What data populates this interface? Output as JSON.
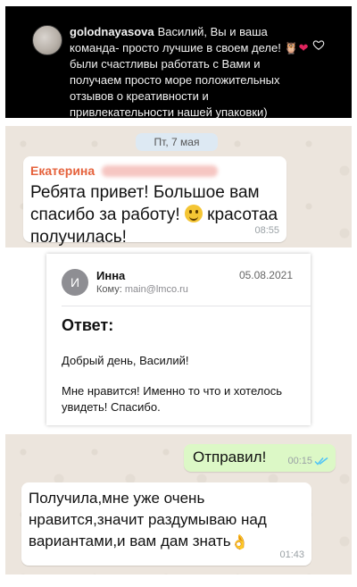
{
  "instagram": {
    "username": "golodnayasova",
    "comment_part1": "Василий, Вы и ваша команда- просто лучшие в своем деле! ",
    "comment_part2": " были счастливы работать с Вами и получаем просто море положительных отзывов о креативности и привлекательности нашей упаковки)",
    "icons": [
      "avatar",
      "owl-emoji",
      "red-heart-emoji",
      "like-heart-icon"
    ]
  },
  "chat1": {
    "date": "Пт, 7 мая",
    "sender": "Екатерина",
    "message_part1": "Ребята привет! Большое вам спасибо за работу! ",
    "message_part2": " красотаа получилась!",
    "time": "08:55"
  },
  "email": {
    "avatar_letter": "И",
    "from": "Инна",
    "to_label": "Кому:",
    "to_address": "main@lmco.ru",
    "date": "05.08.2021",
    "subject": "Ответ:",
    "greeting": "Добрый день, Василий!",
    "body": "Мне нравится! Именно то что и хотелось увидеть! Спасибо."
  },
  "chat2": {
    "outgoing": {
      "text": "Отправил!",
      "time": "00:15"
    },
    "incoming": {
      "text": "Получила,мне уже очень нравится,значит раздумываю над вариантами,и вам дам знать",
      "time": "01:43"
    }
  },
  "colors": {
    "chat_background": "#ece5dd",
    "outgoing_bubble": "#dcf8c6",
    "sender_name": "#e5623c",
    "read_ticks": "#4fc3f7"
  }
}
